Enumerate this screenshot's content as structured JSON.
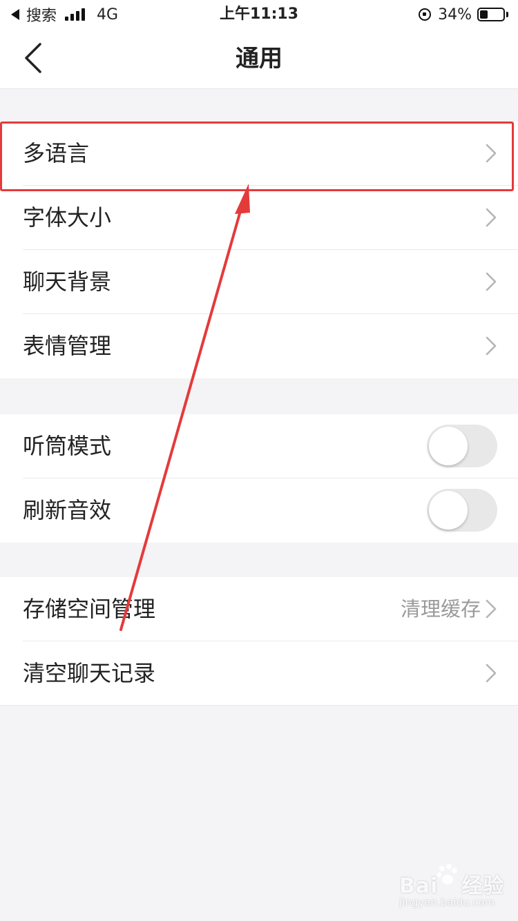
{
  "status_bar": {
    "back_app": "搜索",
    "network": "4G",
    "time": "上午11:13",
    "battery": "34%",
    "battery_level": 0.34
  },
  "nav": {
    "title": "通用",
    "back_icon": "chevron-left-icon"
  },
  "groups": [
    {
      "rows": [
        {
          "label": "多语言",
          "accessory": "chevron"
        },
        {
          "label": "字体大小",
          "accessory": "chevron"
        },
        {
          "label": "聊天背景",
          "accessory": "chevron"
        },
        {
          "label": "表情管理",
          "accessory": "chevron"
        }
      ]
    },
    {
      "rows": [
        {
          "label": "听筒模式",
          "accessory": "toggle",
          "on": false
        },
        {
          "label": "刷新音效",
          "accessory": "toggle",
          "on": false
        }
      ]
    },
    {
      "rows": [
        {
          "label": "存储空间管理",
          "value": "清理缓存",
          "accessory": "chevron"
        },
        {
          "label": "清空聊天记录",
          "accessory": "chevron"
        }
      ]
    }
  ],
  "annotation": {
    "color": "#e43a3a",
    "target": "多语言"
  },
  "watermark": {
    "main": "Bai",
    "main2": "经验",
    "sub": "jingyan.baidu.com"
  },
  "colors": {
    "background": "#f4f3f5",
    "card": "#ffffff",
    "divider": "#e9e9e9",
    "secondary_text": "#9a9a9a",
    "toggle_off": "#e8e8e8"
  }
}
